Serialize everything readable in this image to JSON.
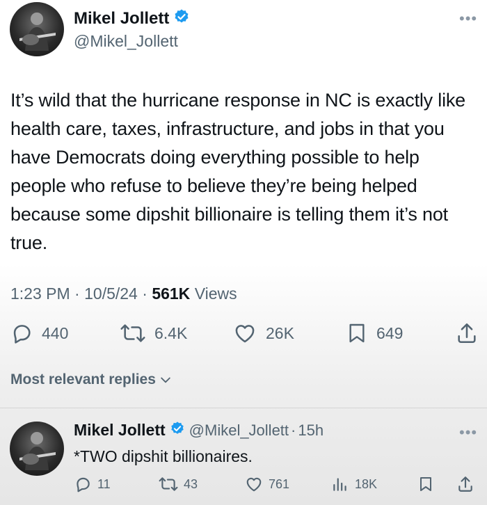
{
  "tweet": {
    "author_name": "Mikel Jollett",
    "author_handle": "@Mikel_Jollett",
    "text": "It’s wild that the hurricane response in NC is exactly like health care, taxes, infrastructure, and jobs in that you have Democrats doing everything possible to help people who refuse to believe they’re being helped because some dipshit billionaire is telling them it’s not true.",
    "time": "1:23 PM",
    "date": "10/5/24",
    "views_count": "561K",
    "views_label": "Views",
    "separator": "·",
    "actions": {
      "replies": "440",
      "reposts": "6.4K",
      "likes": "26K",
      "bookmarks": "649"
    }
  },
  "replies_filter": {
    "label": "Most relevant replies"
  },
  "reply": {
    "author_name": "Mikel Jollett",
    "author_handle": "@Mikel_Jollett",
    "separator": "·",
    "age": "15h",
    "text": "*TWO dipshit billionaires.",
    "actions": {
      "replies": "11",
      "reposts": "43",
      "likes": "761",
      "views": "18K"
    }
  },
  "colors": {
    "verified_blue": "#1d9bf0",
    "text_primary": "#0f1419",
    "text_secondary": "#536471"
  },
  "icons": [
    "more-icon",
    "verified-icon",
    "reply-icon",
    "repost-icon",
    "like-icon",
    "bookmark-icon",
    "share-icon",
    "views-icon",
    "chevron-down-icon"
  ]
}
